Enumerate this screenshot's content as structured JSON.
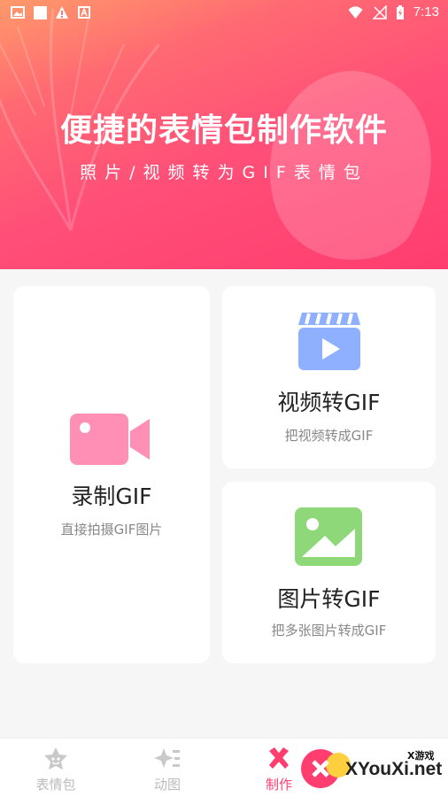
{
  "status_bar": {
    "time": "7:13"
  },
  "banner": {
    "title": "便捷的表情包制作软件",
    "subtitle": "照片/视频转为GIF表情包"
  },
  "cards": {
    "record": {
      "title": "录制GIF",
      "subtitle": "直接拍摄GIF图片",
      "icon": "video-camera-icon",
      "color": "#ff8fb5"
    },
    "video": {
      "title": "视频转GIF",
      "subtitle": "把视频转成GIF",
      "icon": "clapperboard-icon",
      "color": "#8fb0ff"
    },
    "image": {
      "title": "图片转GIF",
      "subtitle": "把多张图片转成GIF",
      "icon": "picture-icon",
      "color": "#8ed87a"
    }
  },
  "tabs": [
    {
      "label": "表情包",
      "icon": "emoji-star-icon",
      "active": false
    },
    {
      "label": "动图",
      "icon": "sparkle-list-icon",
      "active": false
    },
    {
      "label": "制作",
      "icon": "tools-icon",
      "active": true
    }
  ],
  "watermark": {
    "text": "XYouXi.net",
    "small": "X游戏"
  },
  "colors": {
    "accent": "#ff3d6f",
    "background": "#f6f6f6"
  }
}
